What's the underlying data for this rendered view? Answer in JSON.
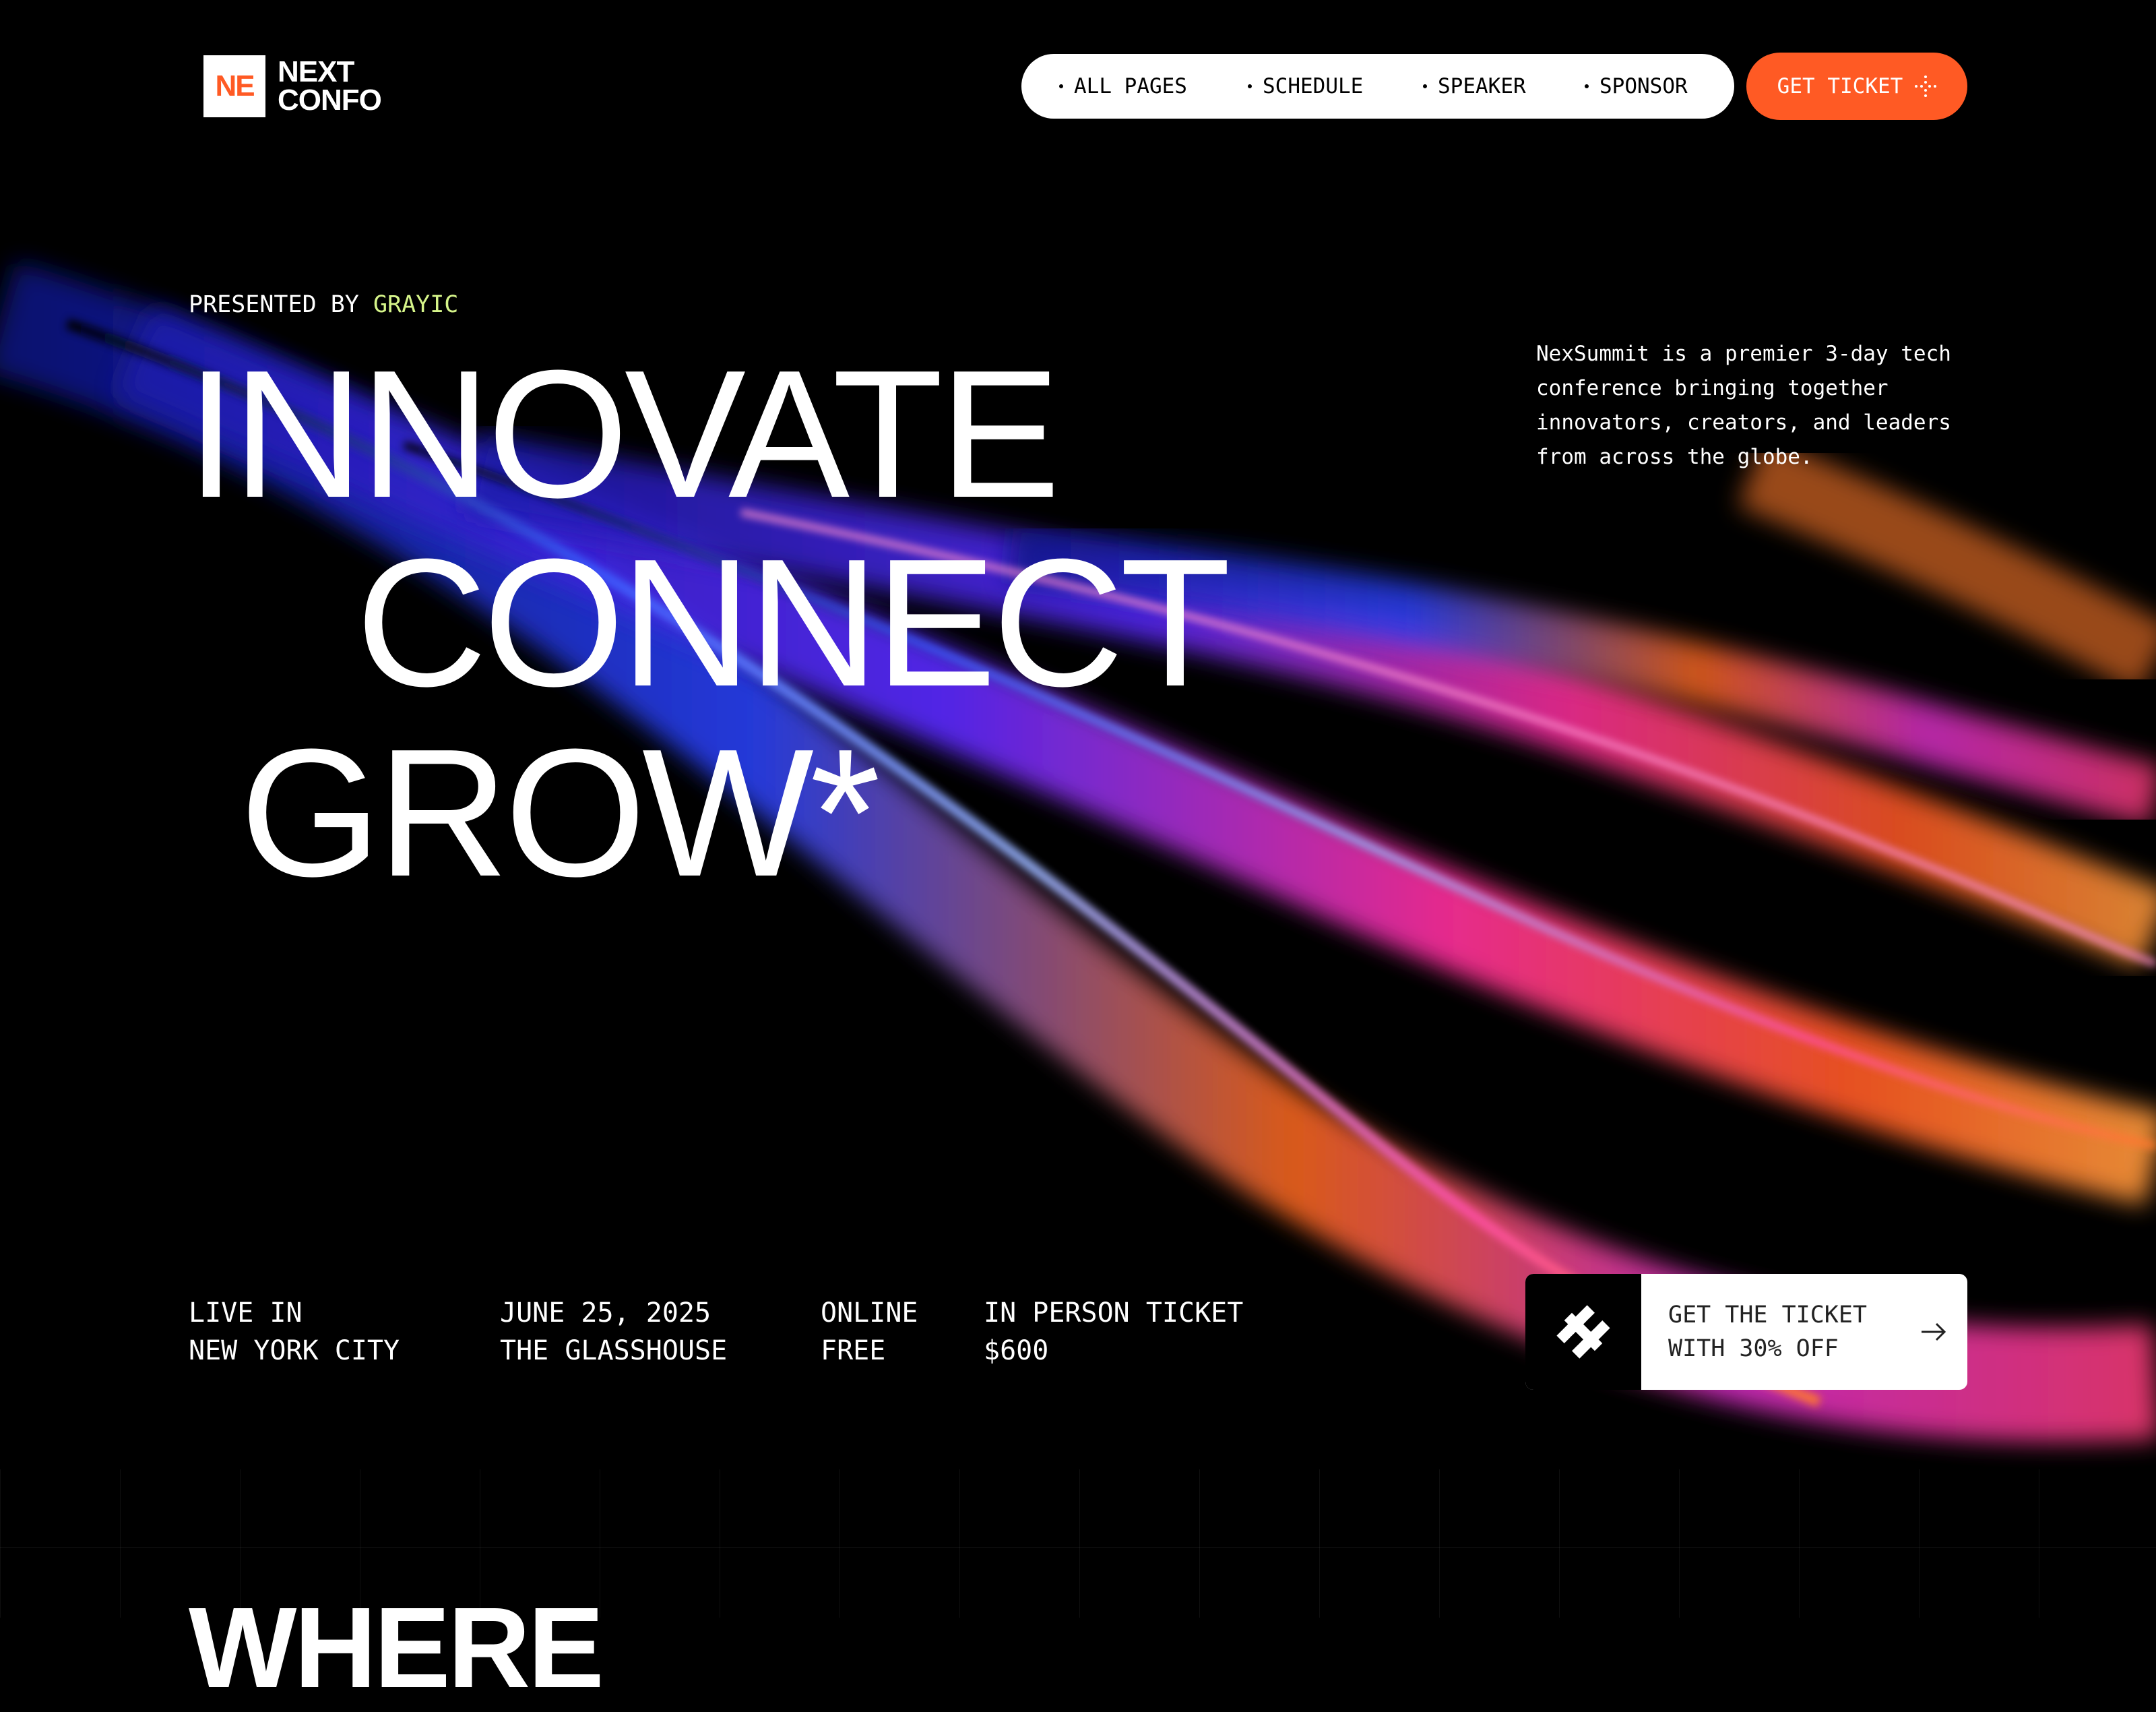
{
  "logo": {
    "mark": "NE",
    "line1": "NEXT",
    "line2": "CONFO"
  },
  "nav": {
    "items": [
      "ALL PAGES",
      "SCHEDULE",
      "SPEAKER",
      "SPONSOR"
    ]
  },
  "header": {
    "ticket_label": "GET TICKET"
  },
  "hero": {
    "presented_prefix": "PRESENTED BY",
    "presented_brand": "GRAYIC",
    "lines": [
      "INNOVATE",
      "CONNECT",
      "GROW*"
    ],
    "blurb": "NexSummit is a premier 3-day tech conference bringing together innovators, creators, and leaders from across the globe."
  },
  "info": [
    {
      "line1": "LIVE IN",
      "line2": "NEW YORK CITY"
    },
    {
      "line1": "JUNE 25, 2025",
      "line2": "THE GLASSHOUSE"
    },
    {
      "line1": "ONLINE",
      "line2": "FREE"
    },
    {
      "line1": "IN PERSON TICKET",
      "line2": "$600"
    }
  ],
  "cta": {
    "line1": "GET THE TICKET",
    "line2": "WITH 30% OFF"
  },
  "next_section": {
    "heading": "WHERE"
  },
  "colors": {
    "accent": "#ff5a24",
    "brand_green": "#d6f58a",
    "background": "#000000"
  },
  "icons": {
    "ticket_button": "sparkle-icon",
    "cta_box": "ticket-logo-icon",
    "cta_arrow": "arrow-right-icon"
  }
}
